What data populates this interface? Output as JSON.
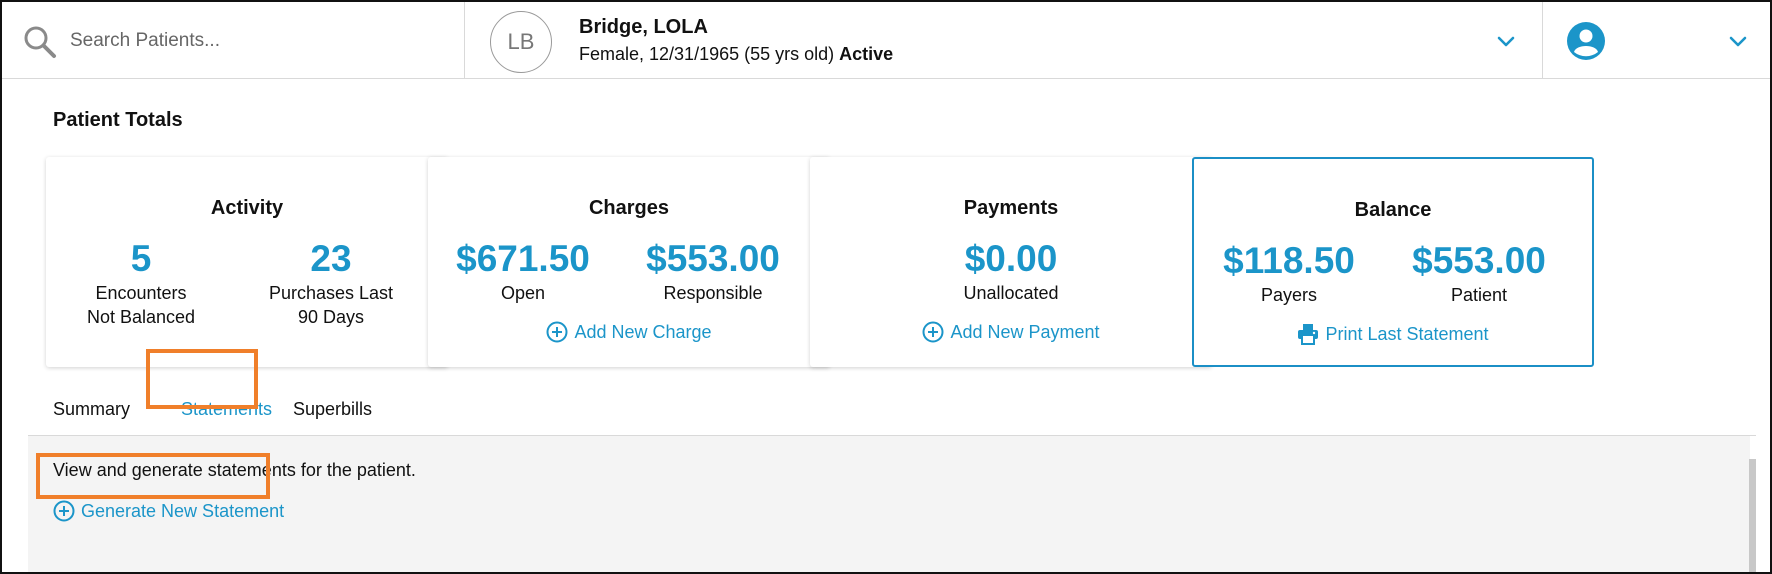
{
  "search": {
    "placeholder": "Search Patients..."
  },
  "patient": {
    "initials": "LB",
    "name": "Bridge, LOLA",
    "info": "Female, 12/31/1965 (55 yrs old) ",
    "status": "Active"
  },
  "section_title": "Patient Totals",
  "cards": {
    "activity": {
      "title": "Activity",
      "stat1": {
        "value": "5",
        "label_line1": "Encounters",
        "label_line2": "Not Balanced"
      },
      "stat2": {
        "value": "23",
        "label_line1": "Purchases Last",
        "label_line2": "90 Days"
      }
    },
    "charges": {
      "title": "Charges",
      "stat1": {
        "value": "$671.50",
        "label": "Open"
      },
      "stat2": {
        "value": "$553.00",
        "label": "Responsible"
      },
      "action": "Add New Charge"
    },
    "payments": {
      "title": "Payments",
      "stat1": {
        "value": "$0.00",
        "label": "Unallocated"
      },
      "action": "Add New Payment"
    },
    "balance": {
      "title": "Balance",
      "stat1": {
        "value": "$118.50",
        "label": "Payers"
      },
      "stat2": {
        "value": "$553.00",
        "label": "Patient"
      },
      "action": "Print Last Statement"
    }
  },
  "tabs": [
    {
      "label": "Summary",
      "active": false
    },
    {
      "label": "Statements",
      "active": true
    },
    {
      "label": "Superbills",
      "active": false
    }
  ],
  "statements_panel": {
    "description": "View and generate statements for the patient.",
    "generate_label": "Generate New Statement"
  },
  "colors": {
    "accent": "#1b95c9",
    "highlight": "#f07f2a"
  }
}
